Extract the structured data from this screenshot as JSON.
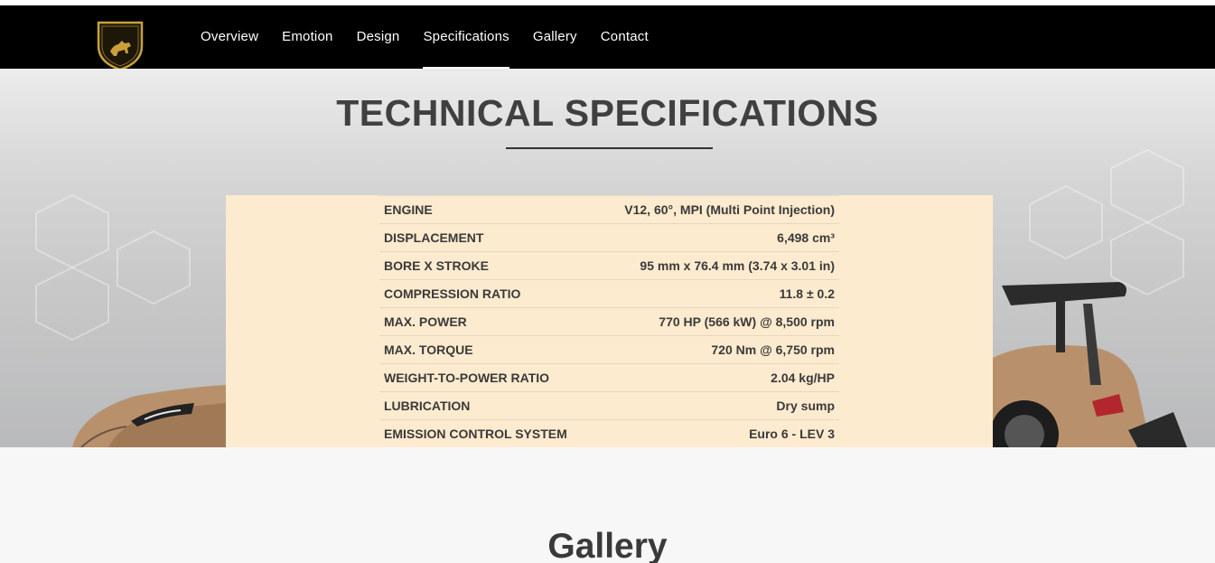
{
  "brand": {
    "logo_text": "LAMBORGHINI"
  },
  "nav": {
    "items": [
      {
        "label": "Overview"
      },
      {
        "label": "Emotion"
      },
      {
        "label": "Design"
      },
      {
        "label": "Specifications",
        "active": true
      },
      {
        "label": "Gallery"
      },
      {
        "label": "Contact"
      }
    ]
  },
  "specs": {
    "title": "TECHNICAL SPECIFICATIONS",
    "rows": [
      {
        "label": "ENGINE",
        "value": "V12, 60°, MPI (Multi Point Injection)"
      },
      {
        "label": "DISPLACEMENT",
        "value": "6,498 cm³"
      },
      {
        "label": "BORE X STROKE",
        "value": "95 mm x 76.4 mm (3.74 x 3.01 in)"
      },
      {
        "label": "COMPRESSION RATIO",
        "value": "11.8 ± 0.2"
      },
      {
        "label": "MAX. POWER",
        "value": "770 HP (566 kW) @ 8,500 rpm"
      },
      {
        "label": "MAX. TORQUE",
        "value": "720 Nm @ 6,750 rpm"
      },
      {
        "label": "WEIGHT-TO-POWER RATIO",
        "value": "2.04 kg/HP"
      },
      {
        "label": "LUBRICATION",
        "value": "Dry sump"
      },
      {
        "label": "EMISSION CONTROL SYSTEM",
        "value": "Euro 6 - LEV 3"
      }
    ]
  },
  "gallery": {
    "title": "Gallery"
  },
  "colors": {
    "nav_bg": "#000000",
    "panel_bg": "#fdebcf",
    "heading": "#404040",
    "car_bronze": "#b8916c",
    "logo_gold": "#c9a03a"
  }
}
